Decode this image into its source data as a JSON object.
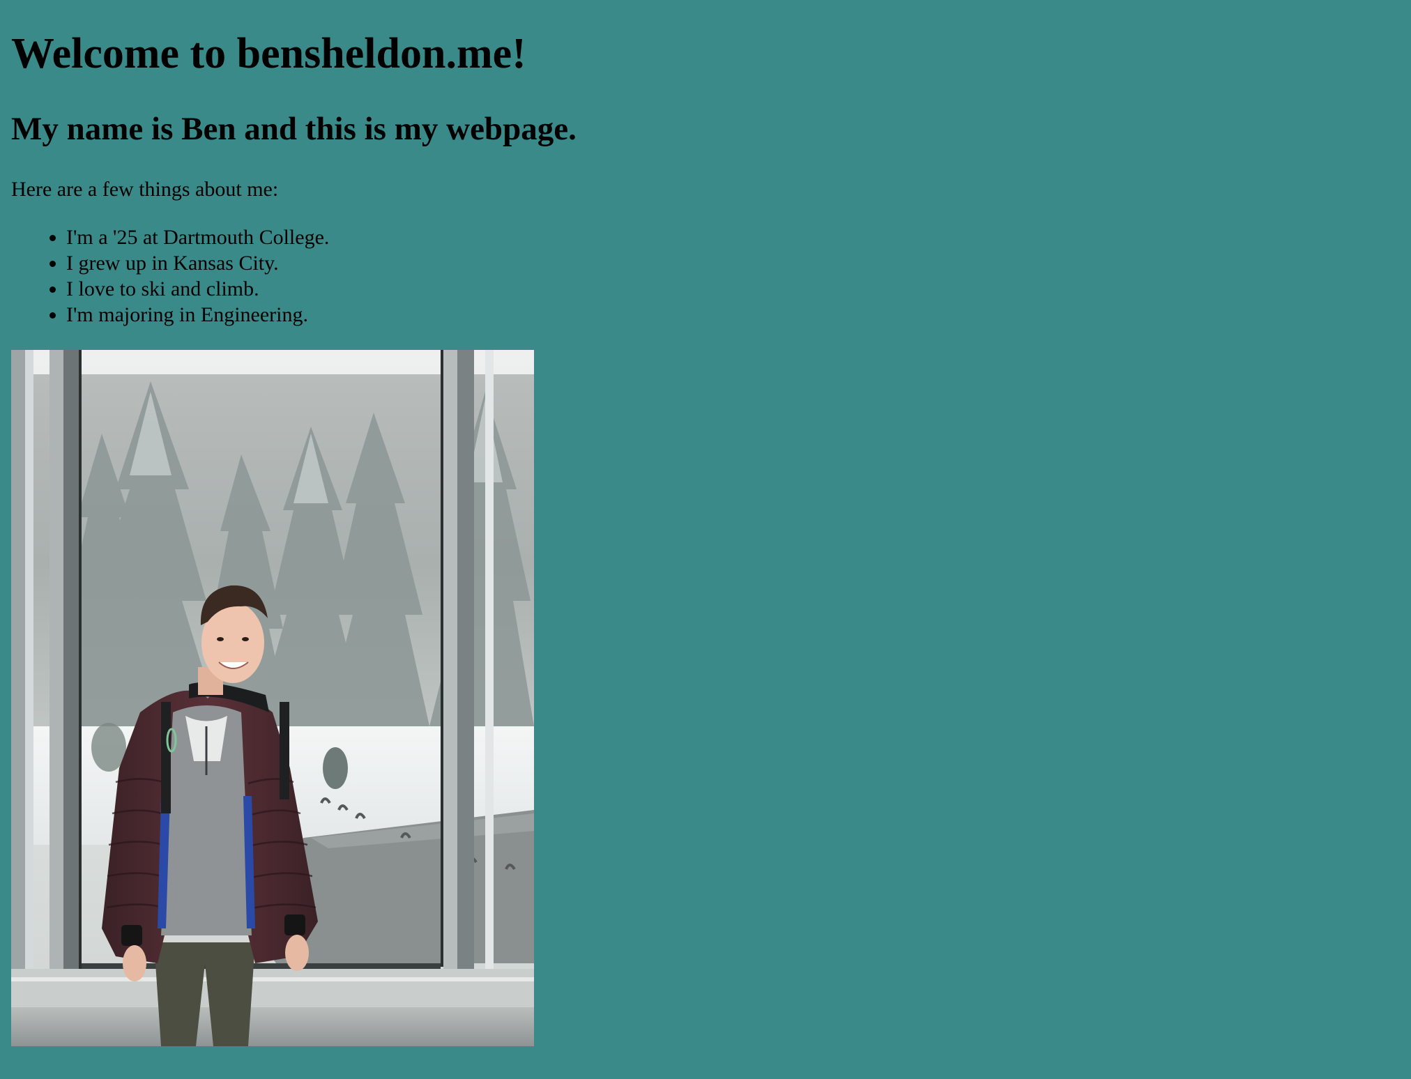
{
  "header": {
    "title": "Welcome to bensheldon.me!",
    "subtitle": "My name is Ben and this is my webpage."
  },
  "intro": "Here are a few things about me:",
  "facts": [
    "I'm a '25 at Dartmouth College.",
    "I grew up in Kansas City.",
    "I love to ski and climb.",
    "I'm majoring in Engineering."
  ],
  "colors": {
    "background": "#3b8a8a"
  }
}
